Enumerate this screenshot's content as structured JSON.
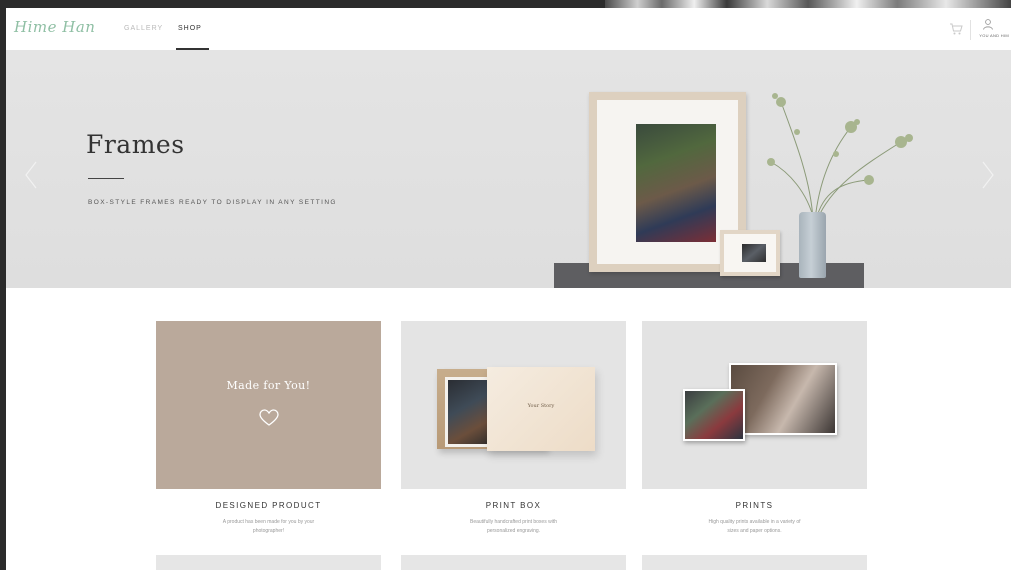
{
  "header": {
    "logo_text": "Hime Han",
    "nav": [
      {
        "label": "GALLERY",
        "active": false
      },
      {
        "label": "SHOP",
        "active": true
      }
    ],
    "user_label": "YOU AND HIM"
  },
  "hero": {
    "title": "Frames",
    "subtitle": "BOX-STYLE FRAMES READY TO DISPLAY IN ANY SETTING"
  },
  "products": [
    {
      "tile_text": "Made for You!",
      "title": "DESIGNED PRODUCT",
      "description_line1": "A product has been made for you by your",
      "description_line2": "photographer!"
    },
    {
      "lid_text": "Your Story",
      "title": "PRINT BOX",
      "description_line1": "Beautifully handcrafted print boxes with",
      "description_line2": "personalized engraving."
    },
    {
      "title": "PRINTS",
      "description_line1": "High quality prints available in a variety of",
      "description_line2": "sizes and paper options."
    }
  ],
  "icons": {
    "cart": "cart-icon",
    "user": "user-icon",
    "heart": "heart-icon",
    "arrow_left": "chevron-left-icon",
    "arrow_right": "chevron-right-icon"
  },
  "colors": {
    "logo": "#8fbfa4",
    "tile_designed": "#baa99b",
    "hero_bg": "#e2e2e2"
  }
}
